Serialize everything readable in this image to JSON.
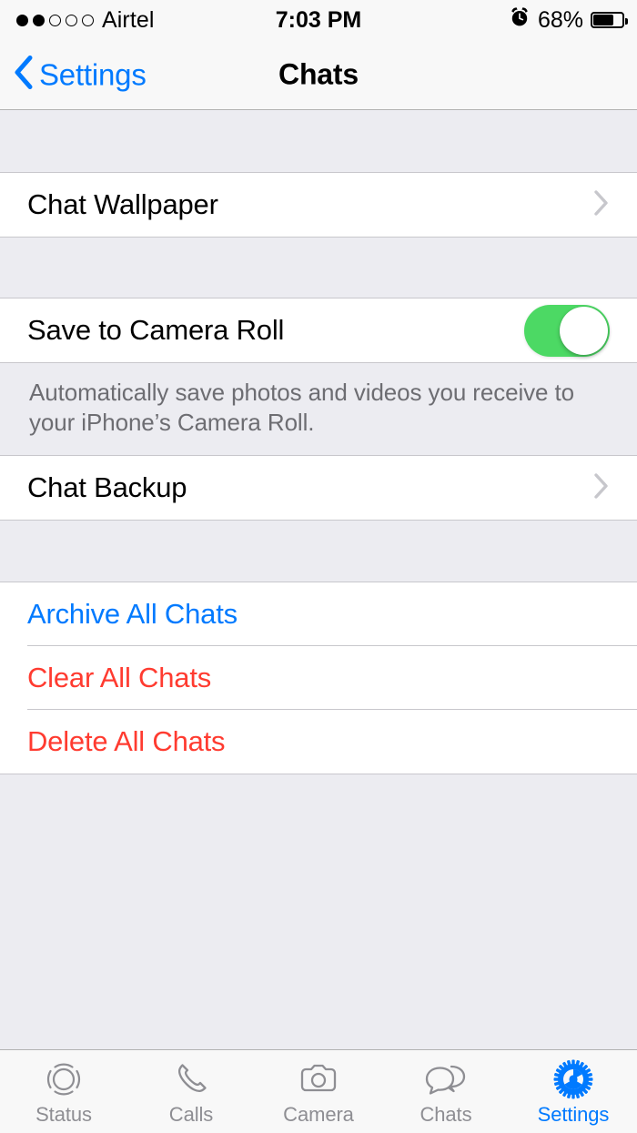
{
  "status_bar": {
    "signal_dots_filled": 2,
    "signal_dots_total": 5,
    "carrier": "Airtel",
    "time": "7:03 PM",
    "alarm_icon": "alarm-clock-icon",
    "battery_percent": "68%",
    "battery_level": 68
  },
  "nav_bar": {
    "back_label": "Settings",
    "back_icon": "chevron-left-icon",
    "title": "Chats"
  },
  "sections": [
    {
      "rows": [
        {
          "label": "Chat Wallpaper",
          "type": "disclosure",
          "accessory": "chevron-right-icon",
          "style": "default"
        }
      ]
    },
    {
      "rows": [
        {
          "label": "Save to Camera Roll",
          "type": "toggle",
          "toggle_on": true,
          "style": "default"
        }
      ],
      "footer": "Automatically save photos and videos you receive to your iPhone’s Camera Roll."
    },
    {
      "rows": [
        {
          "label": "Chat Backup",
          "type": "disclosure",
          "accessory": "chevron-right-icon",
          "style": "default"
        }
      ]
    },
    {
      "rows": [
        {
          "label": "Archive All Chats",
          "type": "action",
          "style": "blue"
        },
        {
          "label": "Clear All Chats",
          "type": "action",
          "style": "red"
        },
        {
          "label": "Delete All Chats",
          "type": "action",
          "style": "red"
        }
      ]
    }
  ],
  "tab_bar": {
    "items": [
      {
        "label": "Status",
        "icon": "status-rings-icon",
        "active": false
      },
      {
        "label": "Calls",
        "icon": "phone-handset-icon",
        "active": false
      },
      {
        "label": "Camera",
        "icon": "camera-icon",
        "active": false
      },
      {
        "label": "Chats",
        "icon": "speech-bubbles-icon",
        "active": false
      },
      {
        "label": "Settings",
        "icon": "gear-icon",
        "active": true
      }
    ]
  },
  "colors": {
    "tint_blue": "#007AFF",
    "destructive_red": "#FF3B30",
    "toggle_on_green": "#4CD964",
    "group_background": "#ECECF1",
    "row_background": "#FFFFFF",
    "separator": "#C8C7CC",
    "secondary_text": "#6D6D72",
    "inactive_tab": "#8E8E93"
  }
}
